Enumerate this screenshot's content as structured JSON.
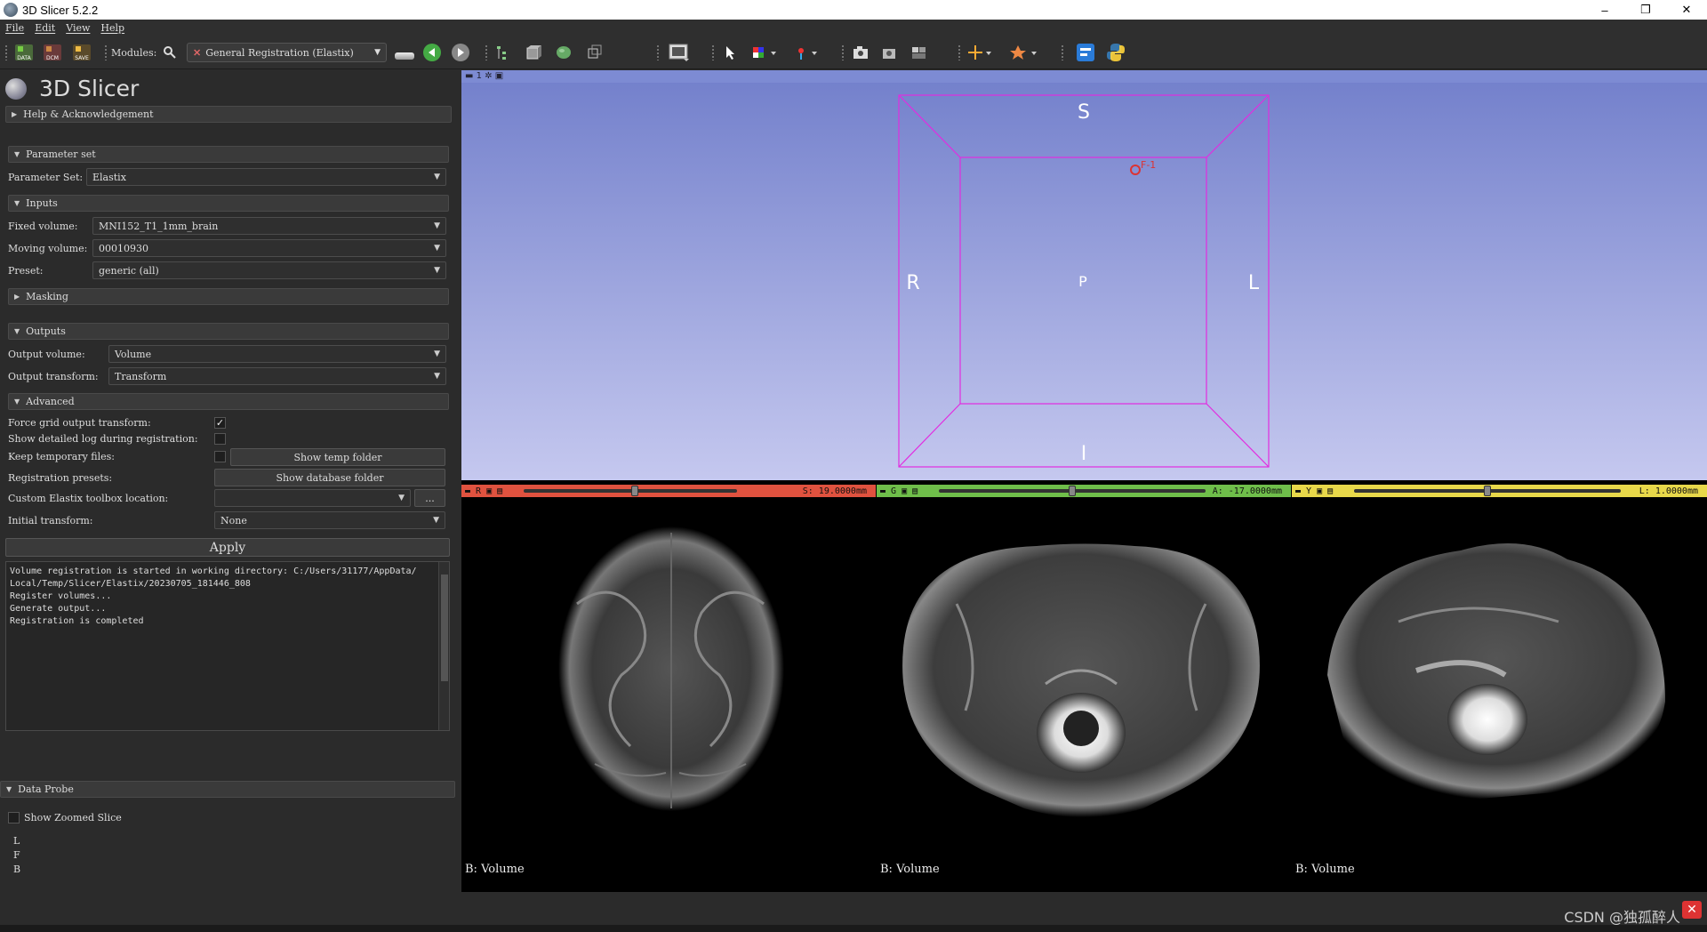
{
  "window": {
    "title": "3D Slicer 5.2.2",
    "minimize": "–",
    "maximize": "❐",
    "close": "✕"
  },
  "menu": [
    "File",
    "Edit",
    "View",
    "Help"
  ],
  "toolbar": {
    "data_label": "DATA",
    "dcm_label": "DCM",
    "save_label": "SAVE",
    "modules_label": "Modules:",
    "module_selected": "General Registration (Elastix)"
  },
  "logo": {
    "text": "3D Slicer"
  },
  "sections": {
    "help": "Help & Acknowledgement",
    "parameter_set": "Parameter set",
    "inputs": "Inputs",
    "masking": "Masking",
    "outputs": "Outputs",
    "advanced": "Advanced",
    "data_probe": "Data Probe"
  },
  "parameter_set": {
    "label": "Parameter Set:",
    "value": "Elastix"
  },
  "inputs": {
    "fixed_label": "Fixed volume:",
    "fixed_value": "MNI152_T1_1mm_brain",
    "moving_label": "Moving volume:",
    "moving_value": "00010930",
    "preset_label": "Preset:",
    "preset_value": "generic (all)"
  },
  "outputs": {
    "volume_label": "Output volume:",
    "volume_value": "Volume",
    "transform_label": "Output transform:",
    "transform_value": "Transform"
  },
  "advanced": {
    "force_grid_label": "Force grid output transform:",
    "force_grid_checked": "✓",
    "detailed_log_label": "Show detailed log during registration:",
    "keep_temp_label": "Keep temporary files:",
    "show_temp_button": "Show temp folder",
    "reg_presets_label": "Registration presets:",
    "show_db_button": "Show database folder",
    "toolbox_label": "Custom Elastix toolbox location:",
    "toolbox_browse": "...",
    "initial_transform_label": "Initial transform:",
    "initial_transform_value": "None"
  },
  "apply_button": "Apply",
  "log": [
    "Volume registration is started in working directory: C:/Users/31177/AppData/",
    "Local/Temp/Slicer/Elastix/20230705_181446_808",
    "Register volumes...",
    "Generate output...",
    "Registration is completed"
  ],
  "data_probe": {
    "show_zoomed": "Show Zoomed Slice",
    "l": "L",
    "f": "F",
    "b": "B"
  },
  "view3d": {
    "tab": "1",
    "S": "S",
    "I": "I",
    "R": "R",
    "L": "L",
    "P": "P",
    "marker": "F-1"
  },
  "slices": {
    "red": {
      "letter": "R",
      "offset": "S: 19.0000mm",
      "label": "B: Volume",
      "color": "#e0523f",
      "pos": 0.52
    },
    "green": {
      "letter": "G",
      "offset": "A: -17.0000mm",
      "label": "B: Volume",
      "color": "#6fbe4a",
      "pos": 0.5
    },
    "yellow": {
      "letter": "Y",
      "offset": "L: 1.0000mm",
      "label": "B: Volume",
      "color": "#e8d84a",
      "pos": 0.5
    }
  },
  "watermark": "CSDN @独孤醉人"
}
